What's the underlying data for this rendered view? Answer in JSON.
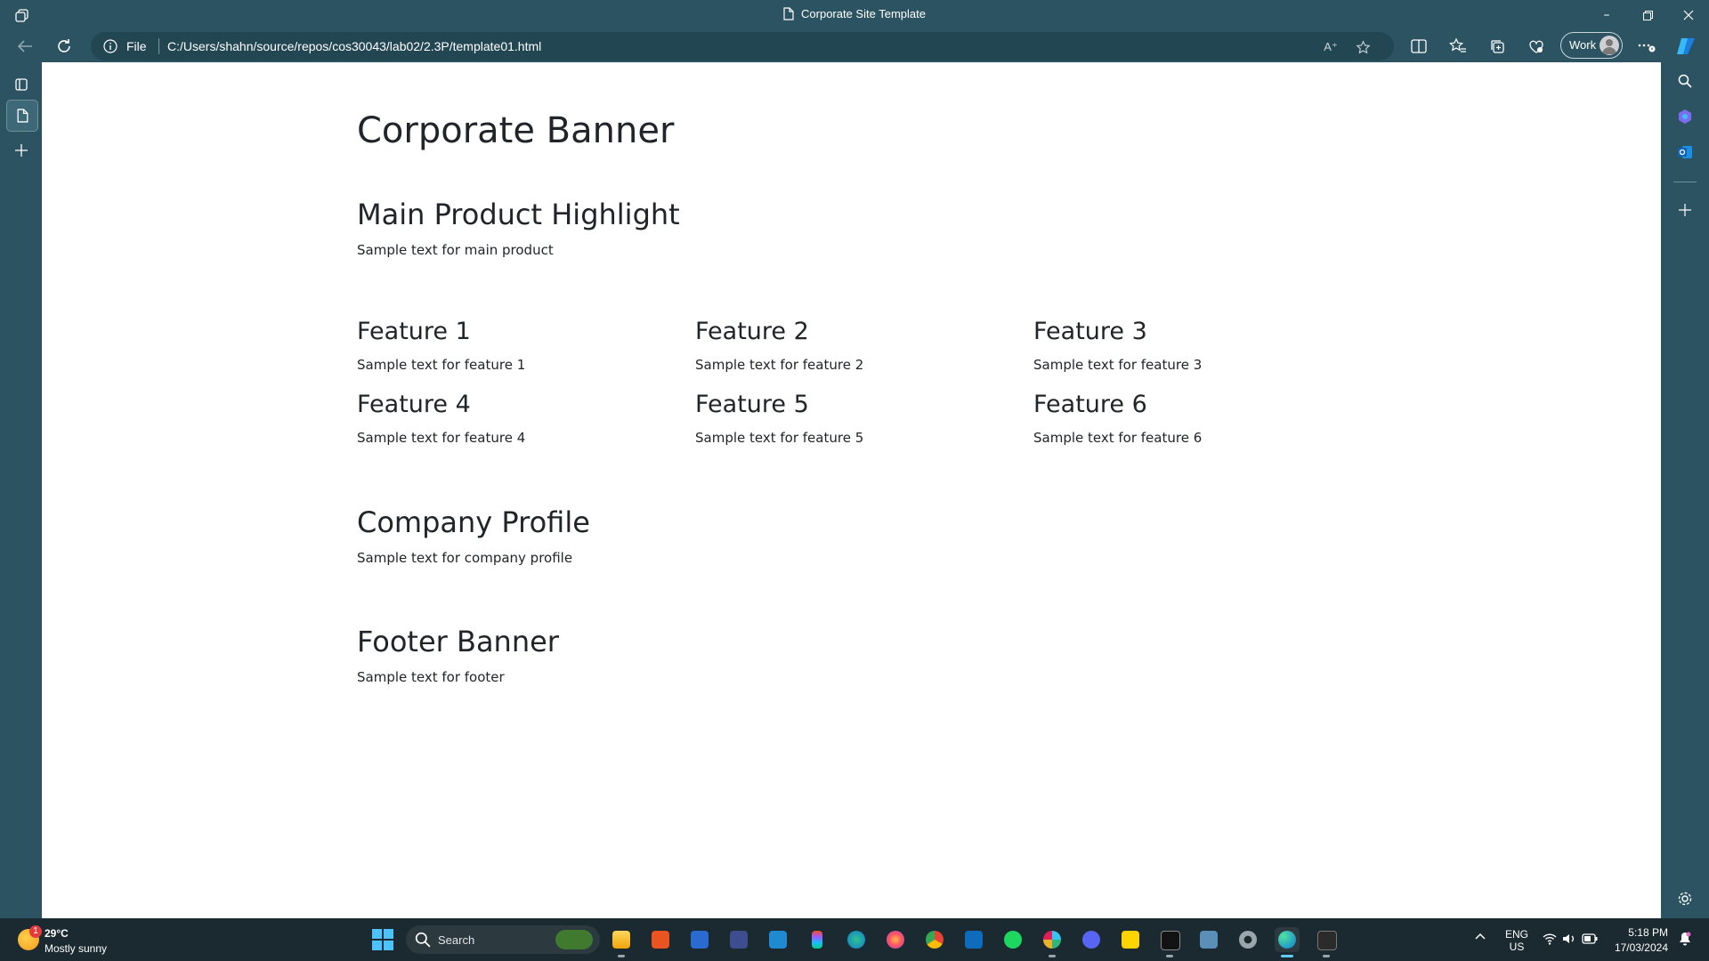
{
  "browser": {
    "window_title": "Corporate Site Template",
    "address": {
      "scheme_label": "File",
      "url": "C:/Users/shahn/source/repos/cos30043/lab02/2.3P/template01.html"
    },
    "profile_label": "Work"
  },
  "page": {
    "banner_title": "Corporate Banner",
    "main_product": {
      "heading": "Main Product Highlight",
      "text": "Sample text for main product"
    },
    "features": [
      {
        "heading": "Feature 1",
        "text": "Sample text for feature 1"
      },
      {
        "heading": "Feature 2",
        "text": "Sample text for feature 2"
      },
      {
        "heading": "Feature 3",
        "text": "Sample text for feature 3"
      },
      {
        "heading": "Feature 4",
        "text": "Sample text for feature 4"
      },
      {
        "heading": "Feature 5",
        "text": "Sample text for feature 5"
      },
      {
        "heading": "Feature 6",
        "text": "Sample text for feature 6"
      }
    ],
    "company_profile": {
      "heading": "Company Profile",
      "text": "Sample text for company profile"
    },
    "footer": {
      "heading": "Footer Banner",
      "text": "Sample text for footer"
    }
  },
  "taskbar": {
    "weather": {
      "temp": "29°C",
      "condition": "Mostly sunny",
      "badge": "1"
    },
    "search_label": "Search",
    "apps": [
      "file-explorer",
      "ubuntu",
      "powershell",
      "visual-studio",
      "vs-code",
      "figma",
      "edge-dev",
      "firefox",
      "chrome",
      "outlook",
      "spotify",
      "slack",
      "discord",
      "sticky-notes",
      "epic-games",
      "remote-desktop",
      "settings",
      "edge",
      "terminal"
    ],
    "language": {
      "line1": "ENG",
      "line2": "US"
    },
    "clock": {
      "time": "5:18 PM",
      "date": "17/03/2024"
    }
  },
  "colors": {
    "chrome": "#2b5361",
    "taskbar": "#1b2a30",
    "page_text": "#212529",
    "accent": "#60cdff"
  }
}
